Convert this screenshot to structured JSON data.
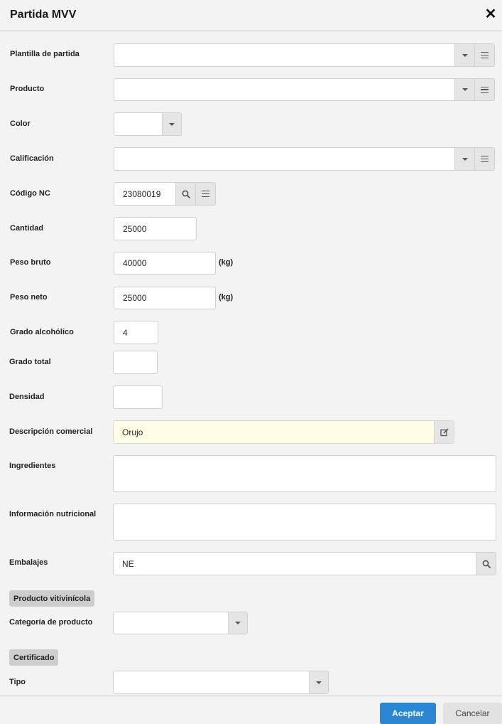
{
  "dialog": {
    "title": "Partida MVV",
    "close_glyph": "✕"
  },
  "fields": {
    "plantilla": {
      "label": "Plantilla de partida",
      "value": ""
    },
    "producto": {
      "label": "Producto",
      "value": ""
    },
    "color": {
      "label": "Color",
      "value": ""
    },
    "calificacion": {
      "label": "Calificación",
      "value": ""
    },
    "codigo_nc": {
      "label": "Código NC",
      "value": "23080019"
    },
    "cantidad": {
      "label": "Cantidad",
      "value": "25000"
    },
    "peso_bruto": {
      "label": "Peso bruto",
      "value": "40000",
      "unit": "(kg)"
    },
    "peso_neto": {
      "label": "Peso neto",
      "value": "25000",
      "unit": "(kg)"
    },
    "grado_alcoholico": {
      "label": "Grado alcohólico",
      "value": "4"
    },
    "grado_total": {
      "label": "Grado total",
      "value": ""
    },
    "densidad": {
      "label": "Densidad",
      "value": ""
    },
    "descripcion_comercial": {
      "label": "Descripción comercial",
      "value": "Orujo"
    },
    "ingredientes": {
      "label": "Ingredientes",
      "value": ""
    },
    "informacion_nutricional": {
      "label": "Información nutricional",
      "value": ""
    },
    "embalajes": {
      "label": "Embalajes",
      "value": "NE"
    }
  },
  "sections": {
    "vitivinicola": {
      "title": "Producto vitivinícola",
      "categoria": {
        "label": "Categoría de producto",
        "value": ""
      }
    },
    "certificado": {
      "title": "Certificado",
      "tipo": {
        "label": "Tipo",
        "value": ""
      }
    }
  },
  "footer": {
    "accept_label": "Aceptar",
    "cancel_label": "Cancelar"
  },
  "colors": {
    "accent": "#2b86d4",
    "highlight_field": "#fefee6"
  },
  "icons": [
    "close-icon",
    "chevron-down-icon",
    "list-icon",
    "search-icon",
    "edit-icon"
  ]
}
